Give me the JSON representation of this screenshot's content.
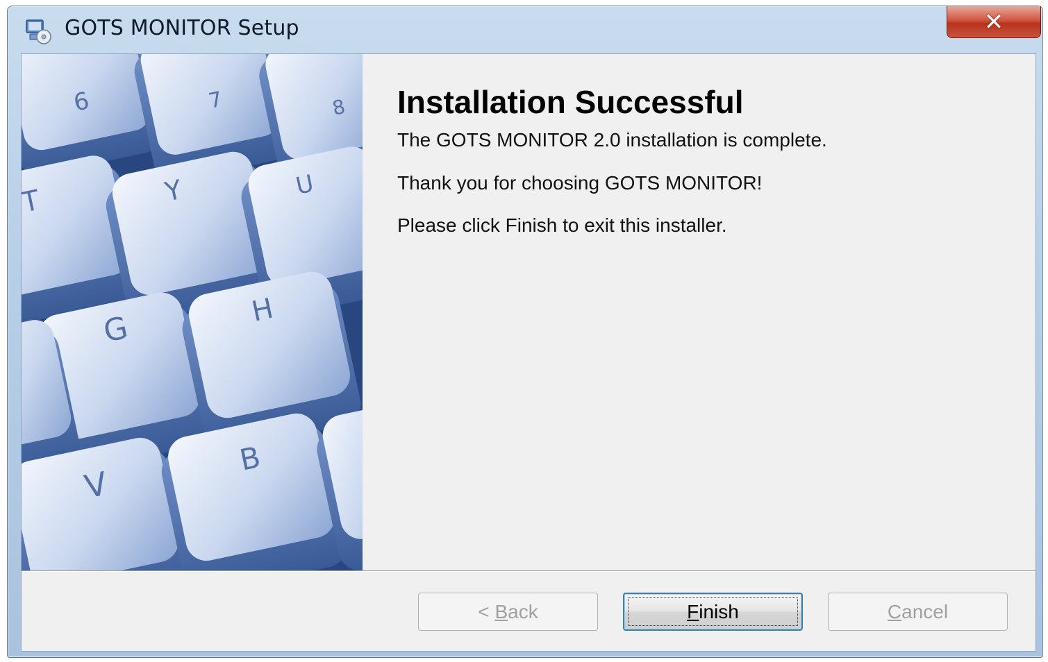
{
  "window": {
    "title": "GOTS MONITOR Setup",
    "close_label": "✕"
  },
  "banner": {
    "keys": [
      "6",
      "7",
      "8",
      "T",
      "Y",
      "U",
      "G",
      "H",
      "V",
      "B"
    ]
  },
  "main": {
    "heading": "Installation Successful",
    "lines": [
      "The GOTS MONITOR 2.0 installation is complete.",
      "Thank you for choosing GOTS MONITOR!",
      "Please click Finish to exit this installer."
    ]
  },
  "buttons": {
    "back": {
      "prefix": "< ",
      "mnemonic": "B",
      "rest": "ack",
      "enabled": false
    },
    "finish": {
      "prefix": "",
      "mnemonic": "F",
      "rest": "inish",
      "enabled": true
    },
    "cancel": {
      "prefix": "",
      "mnemonic": "C",
      "rest": "ancel",
      "enabled": false
    }
  },
  "colors": {
    "accent": "#3c7fb1",
    "close": "#c9523d",
    "client_bg": "#f0f0f0"
  }
}
